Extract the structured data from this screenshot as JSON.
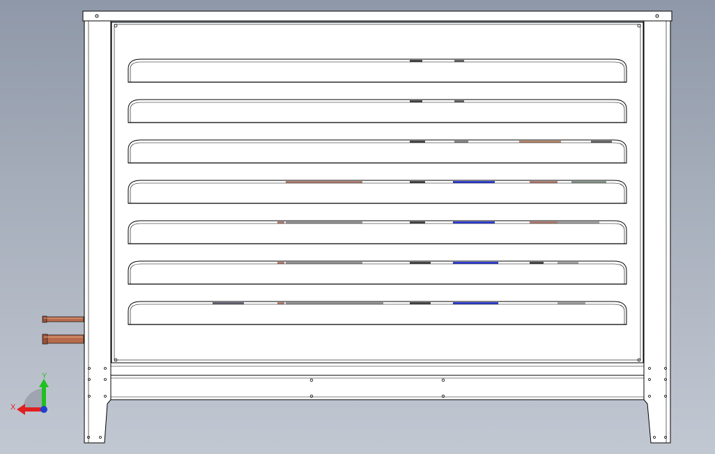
{
  "view": {
    "background_top": "#8f98a8",
    "background_bottom": "#c2c8d2",
    "line_color": "#000000",
    "panel_fill": "#ffffff"
  },
  "louvers": {
    "count": 7
  },
  "pipes": {
    "count": 2,
    "color": "#b86b4b"
  },
  "triad": {
    "x_label": "X",
    "y_label": "Y",
    "x_color": "#e02020",
    "y_color": "#20c020",
    "z_color": "#2040d0"
  }
}
